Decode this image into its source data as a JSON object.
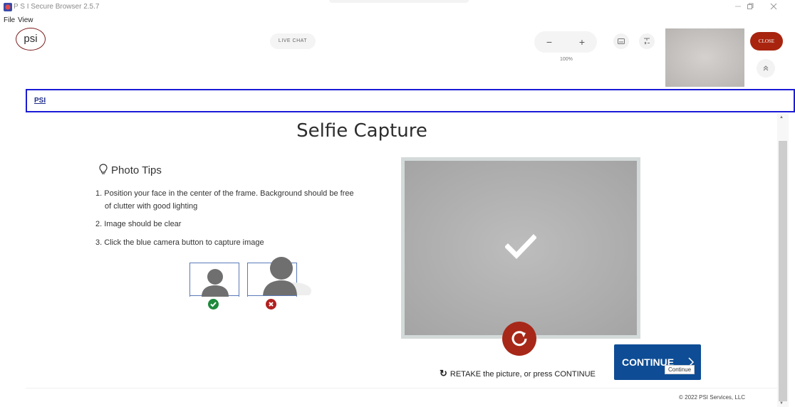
{
  "window": {
    "title": "P S I Secure Browser 2.5.7",
    "restore_icon": "restore-icon",
    "close_icon": "close-icon"
  },
  "menu": [
    "File",
    "View"
  ],
  "toolbar": {
    "logo_text": "psi",
    "live_chat_label": "LIVE CHAT",
    "zoom_out_label": "−",
    "zoom_in_label": "+",
    "zoom_level": "100%",
    "keyboard_icon": "keyboard-icon",
    "calculator_icon": "calculator-icon",
    "close_label": "CLOSE",
    "collapse_icon": "chevron-double-up-icon"
  },
  "tabs": {
    "active_label": "PSI"
  },
  "page": {
    "title": "Selfie Capture",
    "tips_heading": "Photo Tips",
    "tips": [
      "1. Position your face in the center of the frame. Background should be free",
      "of clutter with good lighting",
      "2. Image should be clear",
      "3. Click the blue camera button to capture image"
    ],
    "retake_text": "RETAKE the picture, or press CONTINUE",
    "continue_label": "CONTINUE ",
    "continue_tooltip": "Continue",
    "copyright": "© 2022 PSI Services, LLC"
  },
  "colors": {
    "close_red": "#a8240f",
    "continue_blue": "#0e4d95",
    "tab_outline": "#1b1bd6",
    "good_green": "#1e8a3c",
    "bad_red": "#b22020"
  }
}
